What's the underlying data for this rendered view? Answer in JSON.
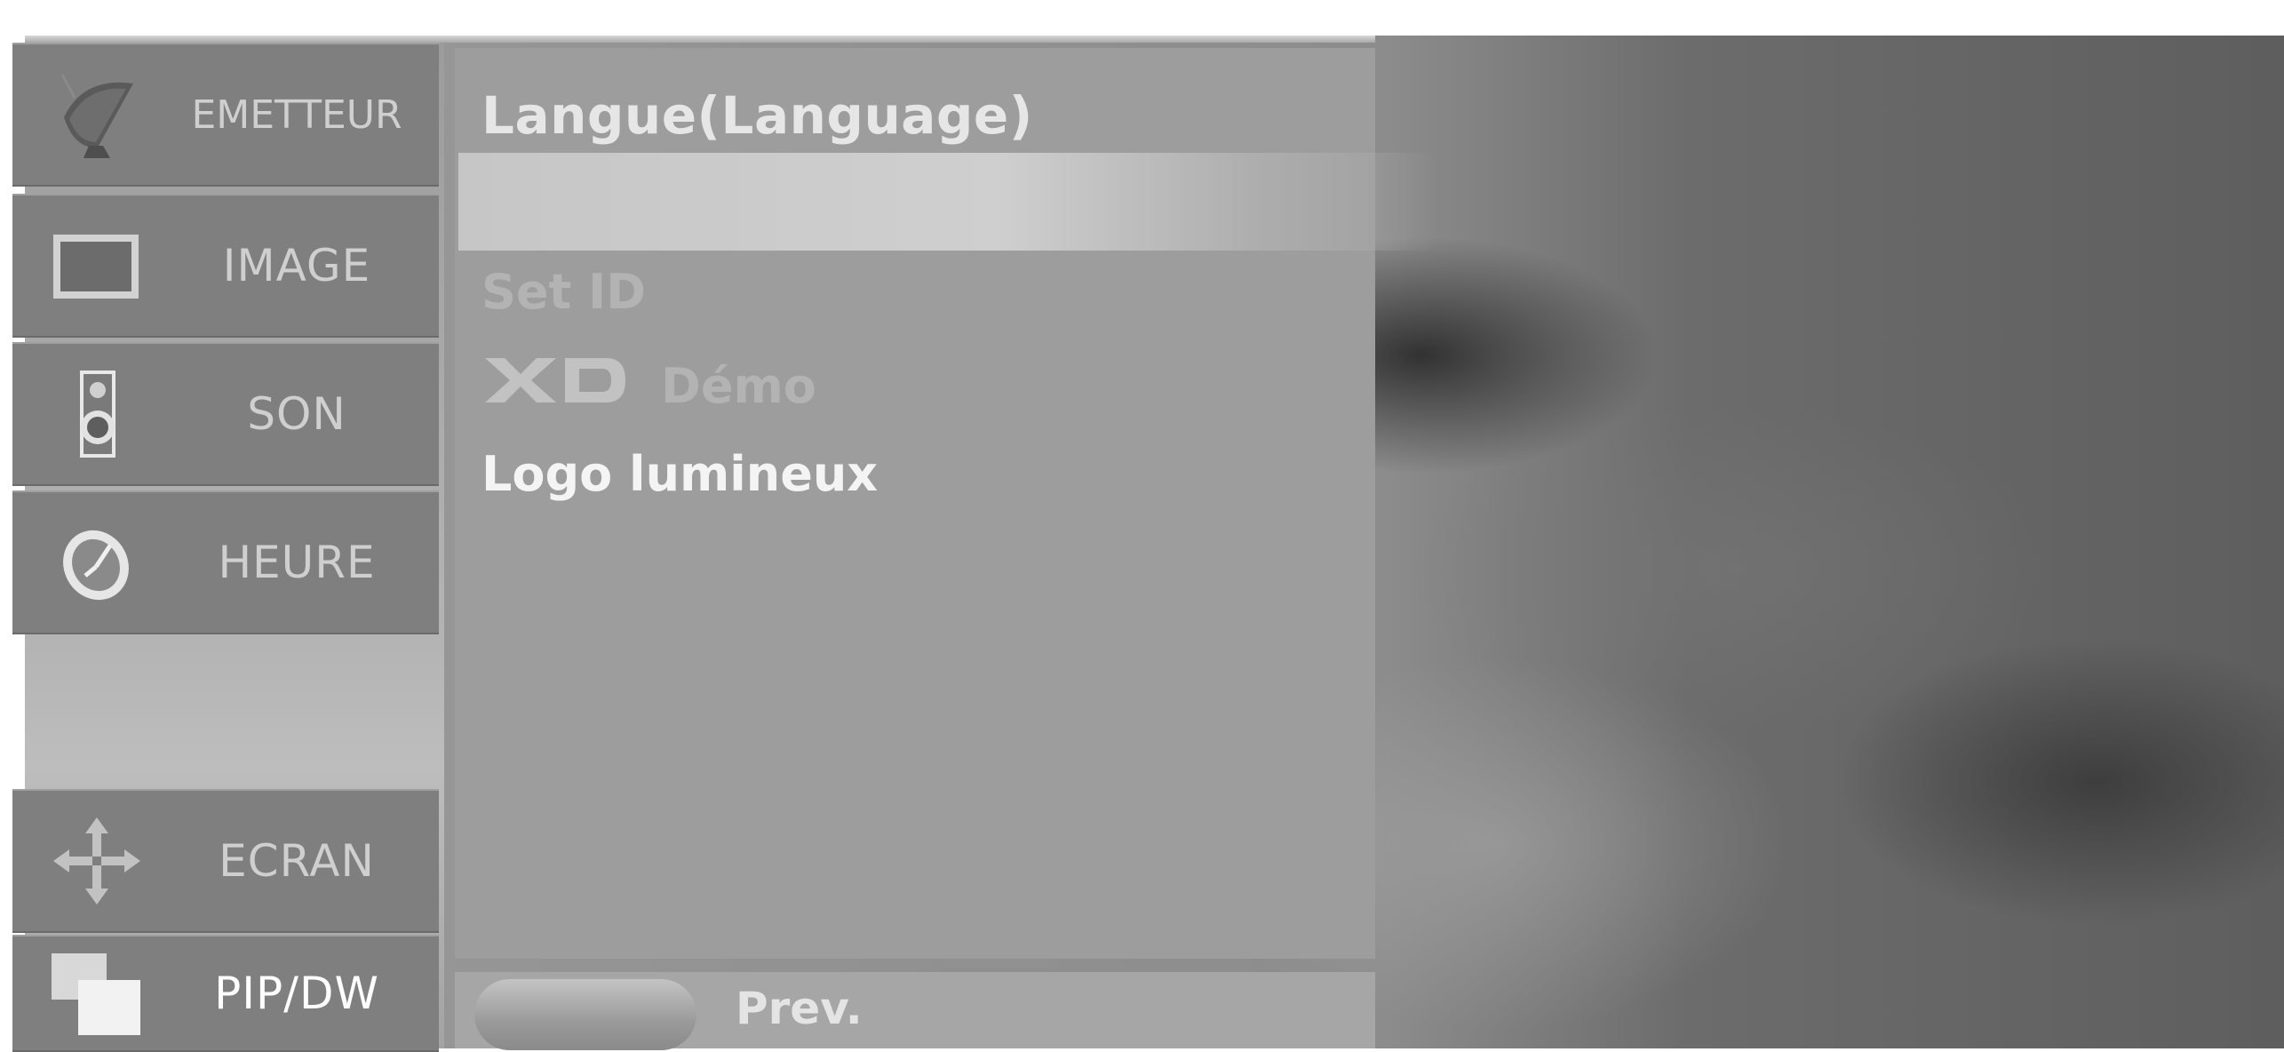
{
  "sidebar": {
    "items": [
      {
        "id": "emetteur",
        "label": "EMETTEUR",
        "icon": "satellite-dish-icon"
      },
      {
        "id": "image",
        "label": "IMAGE",
        "icon": "tv-screen-icon"
      },
      {
        "id": "son",
        "label": "SON",
        "icon": "speaker-icon"
      },
      {
        "id": "heure",
        "label": "HEURE",
        "icon": "clock-icon"
      },
      {
        "id": "ecran",
        "label": "ECRAN",
        "icon": "move-arrows-icon"
      },
      {
        "id": "pip",
        "label": "PIP/DW",
        "icon": "pip-windows-icon",
        "active": true
      }
    ]
  },
  "main": {
    "title": "Langue(Language)",
    "items": [
      {
        "label": "Set ID",
        "enabled": false
      },
      {
        "label": "Démo",
        "prefix_logo": "XD",
        "enabled": false
      },
      {
        "label": "Logo lumineux",
        "enabled": true
      }
    ]
  },
  "bottom_bar": {
    "prev_label": "Prev."
  },
  "colors": {
    "menu_background": "#9d9d9d",
    "nav_item_background": "#7f7f7f",
    "highlight_bar": "#cfcfcf",
    "text_active": "#f4f4f4",
    "text_dim": "#b3b3b3"
  }
}
